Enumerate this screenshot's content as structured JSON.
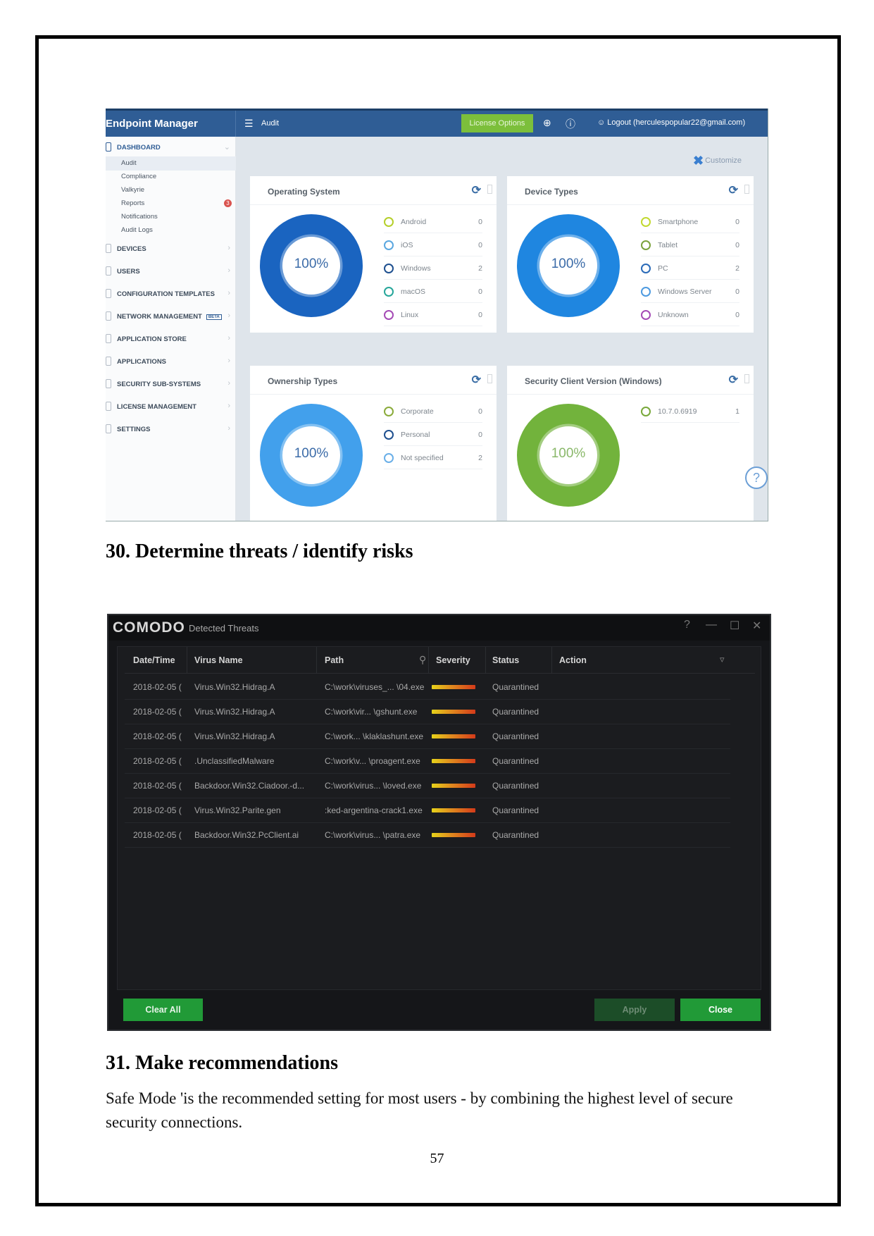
{
  "endpoint_manager": {
    "brand": "Endpoint Manager",
    "menu_icon": "hamburger-icon",
    "breadcrumb": "Audit",
    "license_button": "License Options",
    "header_icons": [
      "add-device-icon",
      "help-icon",
      "user-icon"
    ],
    "logout": "Logout (herculespopular22@gmail.com)",
    "customize": "Customize",
    "sidebar": {
      "dashboard_label": "DASHBOARD",
      "sub_items": [
        {
          "label": "Audit",
          "active": true
        },
        {
          "label": "Compliance"
        },
        {
          "label": "Valkyrie"
        },
        {
          "label": "Reports",
          "badge": "3"
        },
        {
          "label": "Notifications"
        },
        {
          "label": "Audit Logs"
        }
      ],
      "sections": [
        {
          "label": "DEVICES"
        },
        {
          "label": "USERS"
        },
        {
          "label": "CONFIGURATION TEMPLATES"
        },
        {
          "label": "NETWORK MANAGEMENT",
          "tag": "BETA"
        },
        {
          "label": "APPLICATION STORE"
        },
        {
          "label": "APPLICATIONS"
        },
        {
          "label": "SECURITY SUB-SYSTEMS"
        },
        {
          "label": "LICENSE MANAGEMENT"
        },
        {
          "label": "SETTINGS"
        }
      ]
    },
    "cards": [
      {
        "title": "Operating System",
        "center_label": "100%",
        "ring_color": "#1a64c0",
        "legend": [
          {
            "name": "Android",
            "value": "0",
            "color": "#b5cf2a"
          },
          {
            "name": "iOS",
            "value": "0",
            "color": "#5aa7e0"
          },
          {
            "name": "Windows",
            "value": "2",
            "color": "#1e4f8f"
          },
          {
            "name": "macOS",
            "value": "0",
            "color": "#26a69a"
          },
          {
            "name": "Linux",
            "value": "0",
            "color": "#a54bb5"
          }
        ]
      },
      {
        "title": "Device Types",
        "center_label": "100%",
        "ring_color": "#1f86e0",
        "legend": [
          {
            "name": "Smartphone",
            "value": "0",
            "color": "#c2d930"
          },
          {
            "name": "Tablet",
            "value": "0",
            "color": "#7aa23c"
          },
          {
            "name": "PC",
            "value": "2",
            "color": "#2a6ab8"
          },
          {
            "name": "Windows Server",
            "value": "0",
            "color": "#4d9ae0"
          },
          {
            "name": "Unknown",
            "value": "0",
            "color": "#a54bb5"
          }
        ]
      },
      {
        "title": "Ownership Types",
        "center_label": "100%",
        "ring_color": "#42a0ec",
        "legend": [
          {
            "name": "Corporate",
            "value": "0",
            "color": "#8aab3a"
          },
          {
            "name": "Personal",
            "value": "0",
            "color": "#1e4f8f"
          },
          {
            "name": "Not specified",
            "value": "2",
            "color": "#6aafe8"
          }
        ]
      },
      {
        "title": "Security Client Version (Windows)",
        "center_label": "100%",
        "ring_color": "#72b33c",
        "legend": [
          {
            "name": "10.7.0.6919",
            "value": "1",
            "color": "#78a83a"
          }
        ]
      }
    ]
  },
  "document": {
    "heading_30": "30. Determine threats / identify risks",
    "heading_31": "31. Make recommendations",
    "paragraph": "Safe Mode 'is the recommended setting for most users - by combining the highest level of secure security connections.",
    "page_number": "57"
  },
  "comodo": {
    "logo": "COMODO",
    "window_title": "Detected Threats",
    "window_controls": [
      "?",
      "—",
      "☐",
      "✕"
    ],
    "columns": [
      "Date/Time",
      "Virus Name",
      "Path",
      "Severity",
      "Status",
      "Action"
    ],
    "rows": [
      {
        "date": "2018-02-05 (",
        "virus": "Virus.Win32.Hidrag.A",
        "path": "C:\\work\\viruses_... \\04.exe",
        "status": "Quarantined"
      },
      {
        "date": "2018-02-05 (",
        "virus": "Virus.Win32.Hidrag.A",
        "path": "C:\\work\\vir...  \\gshunt.exe",
        "status": "Quarantined"
      },
      {
        "date": "2018-02-05 (",
        "virus": "Virus.Win32.Hidrag.A",
        "path": "C:\\work... \\klaklashunt.exe",
        "status": "Quarantined"
      },
      {
        "date": "2018-02-05 (",
        "virus": ".UnclassifiedMalware",
        "path": "C:\\work\\v... \\proagent.exe",
        "status": "Quarantined"
      },
      {
        "date": "2018-02-05 (",
        "virus": "Backdoor.Win32.Ciadoor.-d...",
        "path": "C:\\work\\virus... \\loved.exe",
        "status": "Quarantined"
      },
      {
        "date": "2018-02-05 (",
        "virus": "Virus.Win32.Parite.gen",
        "path": ":ked-argentina-crack1.exe",
        "status": "Quarantined"
      },
      {
        "date": "2018-02-05 (",
        "virus": "Backdoor.Win32.PcClient.ai",
        "path": "C:\\work\\virus... \\patra.exe",
        "status": "Quarantined"
      }
    ],
    "buttons": {
      "clear_all": "Clear All",
      "apply": "Apply",
      "close": "Close"
    }
  }
}
